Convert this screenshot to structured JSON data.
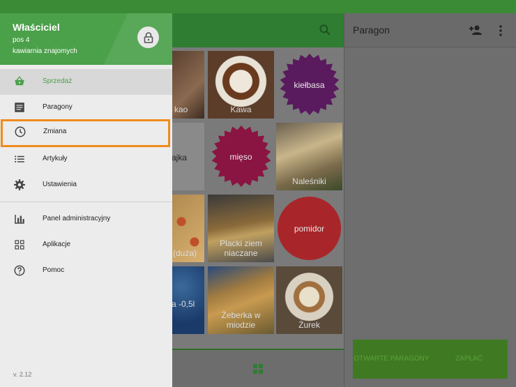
{
  "drawer": {
    "owner": "Właściciel",
    "pos": "pos 4",
    "location": "kawiarnia znajomych",
    "items": [
      {
        "label": "Sprzedaż",
        "icon": "basket-icon"
      },
      {
        "label": "Paragony",
        "icon": "receipt-list-icon"
      },
      {
        "label": "Zmiana",
        "icon": "clock-icon"
      },
      {
        "label": "Artykuły",
        "icon": "list-icon"
      },
      {
        "label": "Ustawienia",
        "icon": "gear-icon"
      },
      {
        "label": "Panel administracyjny",
        "icon": "bar-chart-icon"
      },
      {
        "label": "Aplikacje",
        "icon": "apps-icon"
      },
      {
        "label": "Pomoc",
        "icon": "help-icon"
      }
    ],
    "version": "v. 2.12"
  },
  "tiles": [
    {
      "label": "kao"
    },
    {
      "label": "Kawa"
    },
    {
      "label": "kiełbasa"
    },
    {
      "label": "ajka"
    },
    {
      "label": "mięso"
    },
    {
      "label": "Naleśniki"
    },
    {
      "label": "(duża)"
    },
    {
      "label": "Placki ziem niaczane"
    },
    {
      "label": "pomidor"
    },
    {
      "label": "a -0,5l"
    },
    {
      "label": "Żeberka w miodzie"
    },
    {
      "label": "Żurek"
    }
  ],
  "receipt": {
    "title": "Paragon",
    "open_receipts": "OTWARTE PARAGONY",
    "pay": "ZAPŁAĆ"
  },
  "colors": {
    "accent": "#4ba04a",
    "highlight": "#ef8c1c",
    "kielbasa": "#5a1a5e",
    "mieso": "#8a1442",
    "pomidor": "#a8262a"
  }
}
